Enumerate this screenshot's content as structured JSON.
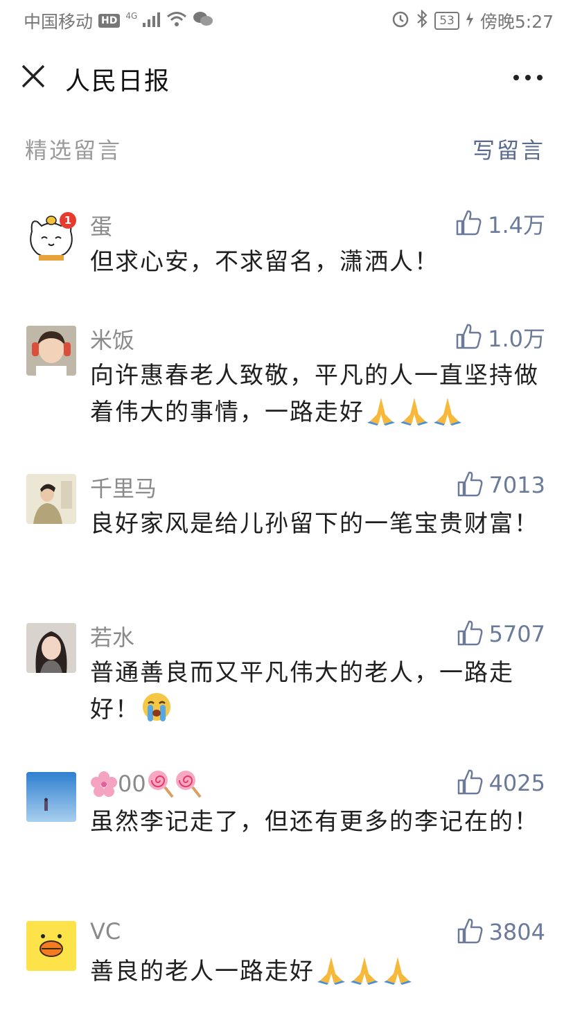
{
  "status_bar": {
    "carrier": "中国移动",
    "hd": "HD",
    "network": "4G",
    "battery": "53",
    "time": "傍晚5:27"
  },
  "nav": {
    "title": "人民日报"
  },
  "section": {
    "label": "精选留言",
    "write_label": "写留言"
  },
  "comments": [
    {
      "nick": "蛋",
      "likes": "1.4万",
      "text": "但求心安，不求留名，潇洒人！",
      "avatar_badge": "1"
    },
    {
      "nick": "米饭",
      "likes": "1.0万",
      "text": "向许惠春老人致敬，平凡的人一直坚持做着伟大的事情，一路走好"
    },
    {
      "nick": "千里马",
      "likes": "7013",
      "text": "良好家风是给儿孙留下的一笔宝贵财富！"
    },
    {
      "nick": "若水",
      "likes": "5707",
      "text": "普通善良而又平凡伟大的老人，一路走好！"
    },
    {
      "nick": "00",
      "likes": "4025",
      "text": "虽然李记走了，但还有更多的李记在的！"
    },
    {
      "nick": "VC",
      "likes": "3804",
      "text": "善良的老人一路走好"
    }
  ],
  "colors": {
    "link": "#5a6a8f",
    "muted": "#9a9a9a",
    "like": "#6b7a99"
  }
}
